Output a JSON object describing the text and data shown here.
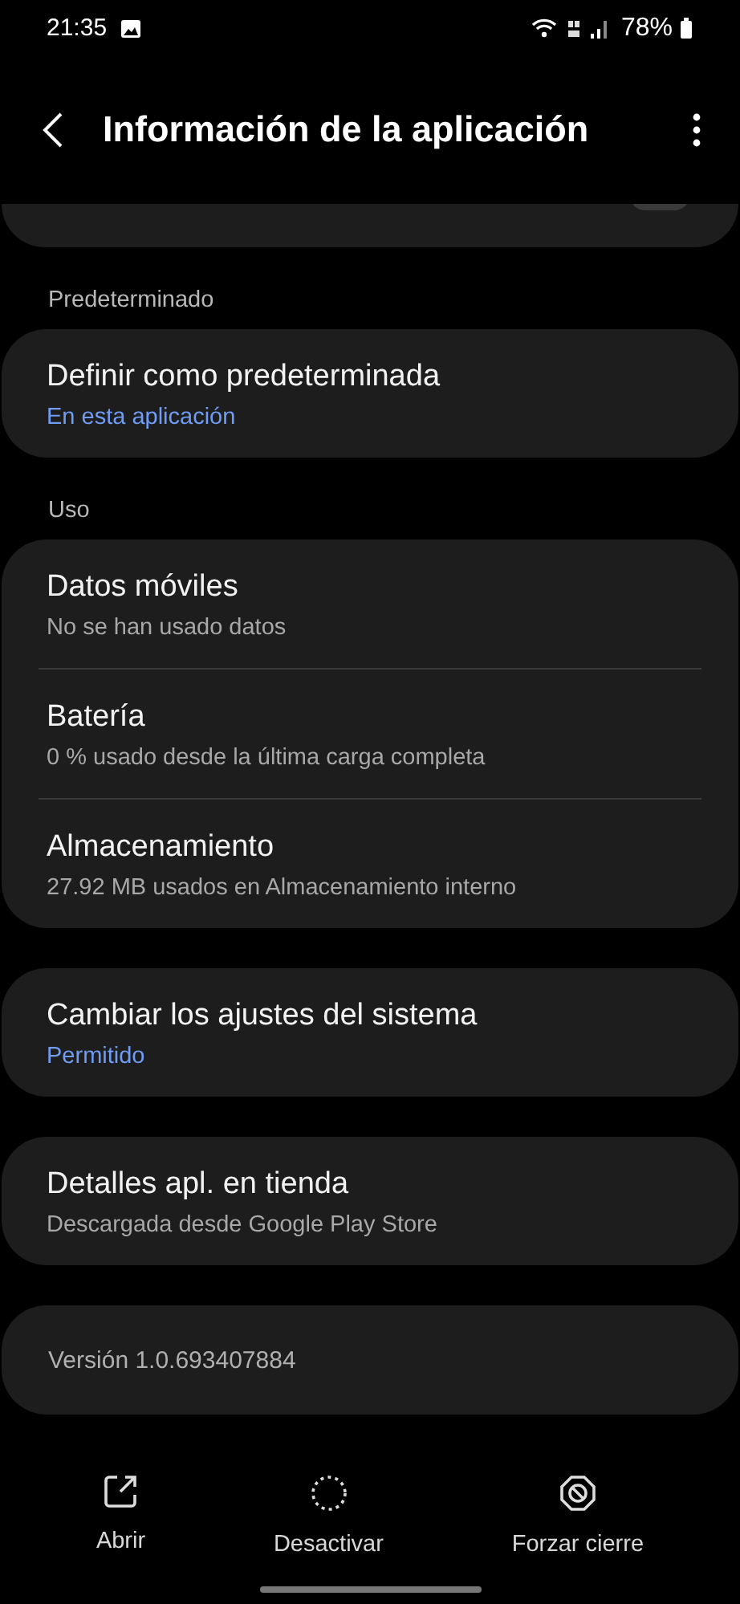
{
  "status_bar": {
    "time": "21:35",
    "battery": "78%"
  },
  "header": {
    "title": "Información de la aplicación"
  },
  "partial_item": {
    "on": false
  },
  "sections": [
    {
      "heading": "Predeterminado",
      "cards": [
        [
          {
            "title": "Definir como predeterminada",
            "subtitle": "En esta aplicación",
            "kind": "link"
          }
        ]
      ]
    },
    {
      "heading": "Uso",
      "cards": [
        [
          {
            "title": "Datos móviles",
            "subtitle": "No se han usado datos",
            "kind": "info"
          },
          {
            "title": "Batería",
            "subtitle": "0 % usado desde la última carga completa",
            "kind": "info"
          },
          {
            "title": "Almacenamiento",
            "subtitle": "27.92 MB usados en Almacenamiento interno",
            "kind": "info"
          }
        ],
        [
          {
            "title": "Cambiar los ajustes del sistema",
            "subtitle": "Permitido",
            "kind": "link"
          }
        ],
        [
          {
            "title": "Detalles apl. en tienda",
            "subtitle": "Descargada desde Google Play Store",
            "kind": "info"
          }
        ]
      ]
    }
  ],
  "version": "Versión 1.0.693407884",
  "actions": [
    {
      "label": "Abrir",
      "kind": "open"
    },
    {
      "label": "Desactivar",
      "kind": "disable"
    },
    {
      "label": "Forzar cierre",
      "kind": "stop"
    }
  ]
}
